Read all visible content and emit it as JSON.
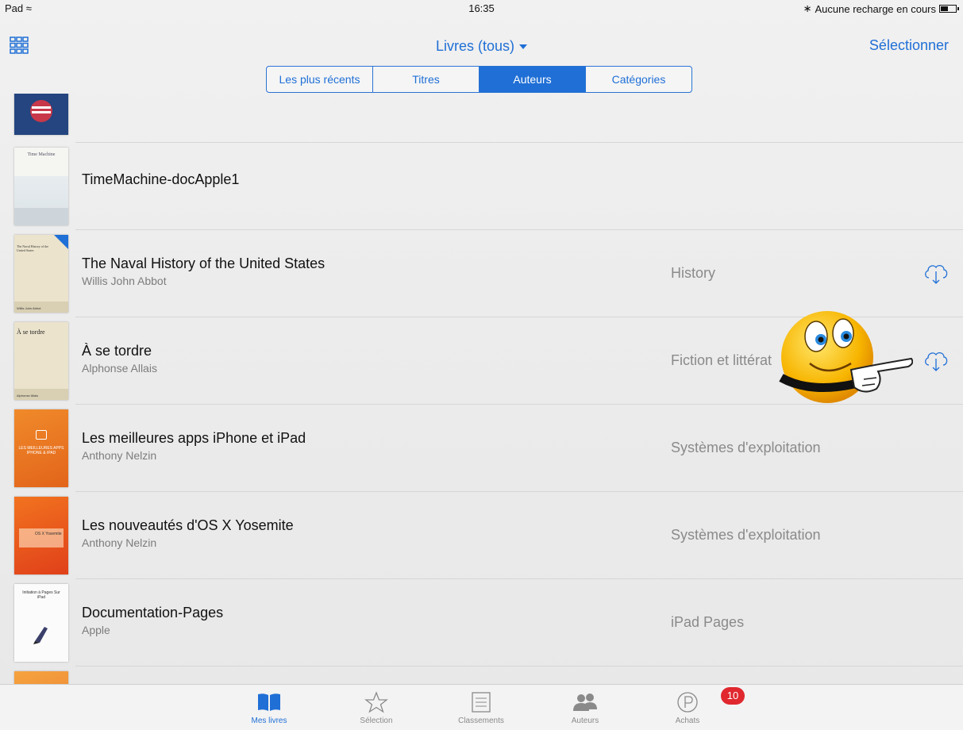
{
  "status_bar": {
    "carrier": "Pad",
    "time": "16:35",
    "battery_text": "Aucune recharge en cours"
  },
  "nav": {
    "title": "Livres (tous)",
    "select_label": "Sélectionner"
  },
  "segments": [
    {
      "label": "Les plus récents",
      "active": false
    },
    {
      "label": "Titres",
      "active": false
    },
    {
      "label": "Auteurs",
      "active": true
    },
    {
      "label": "Catégories",
      "active": false
    }
  ],
  "books": [
    {
      "title": "TimeMachine-docApple1",
      "author": "",
      "category": "",
      "cloud": false
    },
    {
      "title": "The Naval History of the United States",
      "author": "Willis John Abbot",
      "category": "History",
      "cloud": true
    },
    {
      "title": "À se tordre",
      "author": "Alphonse Allais",
      "category": "Fiction et littérat",
      "cloud": true
    },
    {
      "title": "Les meilleures apps iPhone et iPad",
      "author": "Anthony Nelzin",
      "category": "Systèmes d'exploitation",
      "cloud": false
    },
    {
      "title": "Les nouveautés d'OS X Yosemite",
      "author": "Anthony Nelzin",
      "category": "Systèmes d'exploitation",
      "cloud": false
    },
    {
      "title": "Documentation-Pages",
      "author": "Apple",
      "category": "iPad Pages",
      "cloud": false
    }
  ],
  "covers": {
    "timemachine": "Time Machine",
    "naval": "The Naval History of the United States",
    "naval_author": "Willis John Abbot",
    "tordre": "À se tordre",
    "tordre_author": "Alphonse Allais",
    "apps": "LES MEILLEURES APPS IPHONE & IPAD",
    "yosemite": "OS X Yosemite",
    "pages": "Initiation à Pages Sur iPad"
  },
  "tabs": [
    {
      "label": "Mes livres",
      "icon": "book-icon",
      "active": true
    },
    {
      "label": "Sélection",
      "icon": "star-icon",
      "active": false
    },
    {
      "label": "Classements",
      "icon": "list-icon",
      "active": false
    },
    {
      "label": "Auteurs",
      "icon": "authors-icon",
      "active": false
    },
    {
      "label": "Achats",
      "icon": "purchases-icon",
      "active": false
    }
  ],
  "badge": "10",
  "colors": {
    "accent": "#1f6fd6",
    "badge": "#e0282e"
  }
}
